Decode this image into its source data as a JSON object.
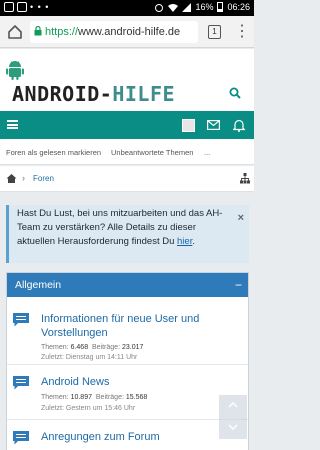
{
  "status_bar": {
    "battery": "16%",
    "time": "06:26",
    "dots": "• • •"
  },
  "browser": {
    "url_scheme": "https://",
    "url_host": "www.android-hilfe.de",
    "tab_count": "1"
  },
  "site": {
    "logo_part1": "ANDROID-",
    "logo_part2": "HILFE"
  },
  "subnav": {
    "mark_read": "Foren als gelesen markieren",
    "unanswered": "Unbeantwortete Themen",
    "more": "..."
  },
  "breadcrumb": {
    "separator": "›",
    "current": "Foren"
  },
  "notice": {
    "text": "Hast Du Lust, bei uns mitzuarbeiten und das AH-Team zu verstärken? Alle Details zu dieser aktuellen Herausforderung findest Du ",
    "link": "hier",
    "end": ".",
    "close": "×"
  },
  "forum": {
    "header": "Allgemein",
    "collapse": "−",
    "nodes": [
      {
        "title": "Informationen für neue User und Vorstellungen",
        "threads_label": "Themen:",
        "threads": "6.468",
        "posts_label": "Beiträge:",
        "posts": "23.017",
        "last": "Zuletzt: Dienstag um 14:11 Uhr"
      },
      {
        "title": "Android News",
        "threads_label": "Themen:",
        "threads": "10.897",
        "posts_label": "Beiträge:",
        "posts": "15.568",
        "last": "Zuletzt: Gestern um 15:46 Uhr"
      },
      {
        "title": "Anregungen zum Forum"
      }
    ]
  },
  "colors": {
    "navbar": "#0a8d84",
    "block_header": "#2f7ab8",
    "link": "#1f6aa5"
  }
}
